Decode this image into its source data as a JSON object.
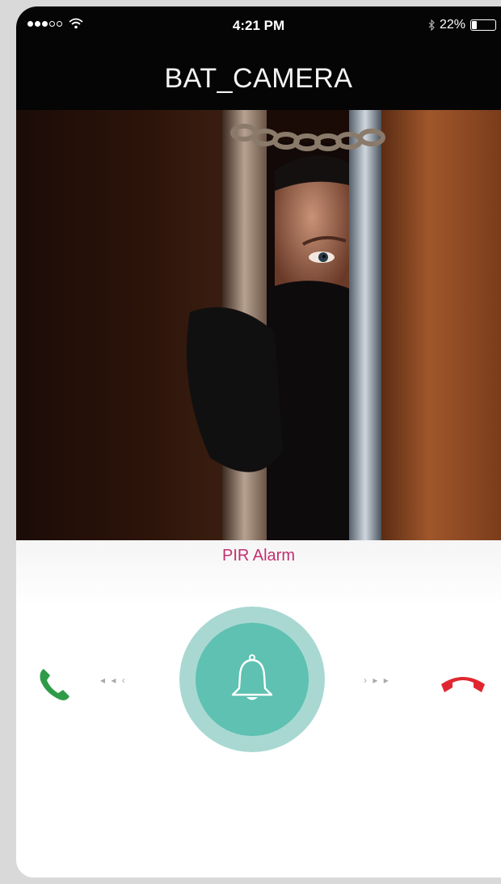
{
  "status_bar": {
    "time": "4:21 PM",
    "battery_label": "22%",
    "battery_level": 0.22,
    "signal_bars_filled": 3,
    "signal_bars_total": 5
  },
  "header": {
    "title": "BAT_CAMERA"
  },
  "feed": {
    "image": "camera-feed-intruder-behind-door-chain"
  },
  "alarm": {
    "label": "PIR Alarm"
  },
  "controls": {
    "accept_icon": "phone-answer-icon",
    "decline_icon": "phone-hangup-icon",
    "center_icon": "bell-icon",
    "hint_left": "◂ ◂ ‹",
    "hint_right": "› ▸ ▸"
  },
  "colors": {
    "header_bg": "#050505",
    "alarm_text": "#c0306e",
    "bell_outer": "#a9d8d2",
    "bell_inner": "#5ec1b1",
    "accept": "#2e9b48",
    "decline": "#e0272f"
  }
}
